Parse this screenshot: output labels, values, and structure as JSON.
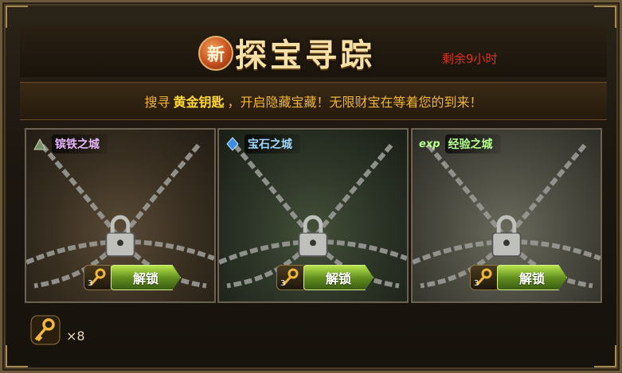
{
  "header": {
    "new_badge": "新",
    "title": "探宝寻踪",
    "time_left": "剩余9小时"
  },
  "banner": {
    "part1": "搜寻",
    "highlight": "黄金钥匙",
    "part2": "，开启隐藏宝藏！无限财宝在等着您的到来！"
  },
  "cards": [
    {
      "name": "镔铁之城",
      "icon": "ore-pile-icon",
      "key_count": "3",
      "unlock_label": "解锁"
    },
    {
      "name": "宝石之城",
      "icon": "blue-gem-icon",
      "key_count": "3",
      "unlock_label": "解锁"
    },
    {
      "name": "经验之城",
      "icon": "exp-icon",
      "icon_text": "exp",
      "key_count": "3",
      "unlock_label": "解锁"
    }
  ],
  "inventory": {
    "icon": "golden-key-icon",
    "count": "×8"
  },
  "colors": {
    "accent_gold": "#f7dfa6",
    "timer_red": "#e0321d",
    "button_green": "#5e8a1e"
  }
}
